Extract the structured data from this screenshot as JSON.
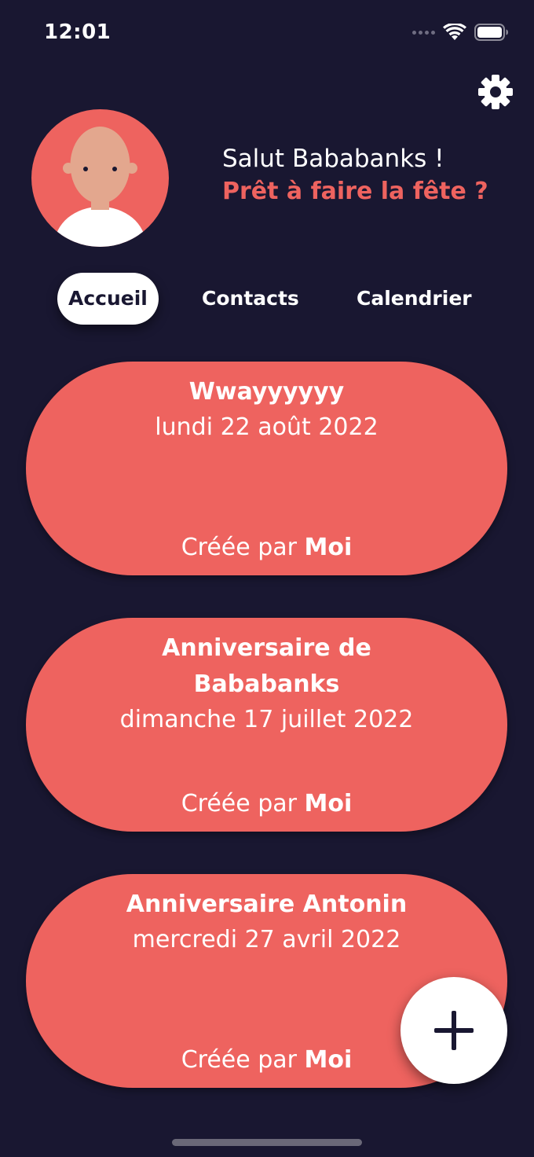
{
  "status_bar": {
    "time": "12:01",
    "icons": [
      "cellular-dots-icon",
      "wifi-icon",
      "battery-icon"
    ]
  },
  "header": {
    "settings_icon": "gear-icon",
    "avatar_icon": "bald-person-avatar",
    "greeting": "Salut Bababanks !",
    "subtitle": "Prêt à faire la fête ?"
  },
  "tabs": [
    {
      "label": "Accueil",
      "active": true
    },
    {
      "label": "Contacts",
      "active": false
    },
    {
      "label": "Calendrier",
      "active": false
    }
  ],
  "events": [
    {
      "title": "Wwayyyyyy",
      "date": "lundi 22 août 2022",
      "created_prefix": "Créée par",
      "creator": "Moi"
    },
    {
      "title": "Anniversaire de Bababanks",
      "date": "dimanche 17 juillet 2022",
      "created_prefix": "Créée par",
      "creator": "Moi"
    },
    {
      "title": "Anniversaire Antonin",
      "date": "mercredi 27 avril 2022",
      "created_prefix": "Créée par",
      "creator": "Moi"
    }
  ],
  "fab": {
    "icon": "plus-icon"
  },
  "colors": {
    "background": "#191731",
    "accent": "#ee635f",
    "tab_active_bg": "#ffffff",
    "text": "#ffffff"
  }
}
